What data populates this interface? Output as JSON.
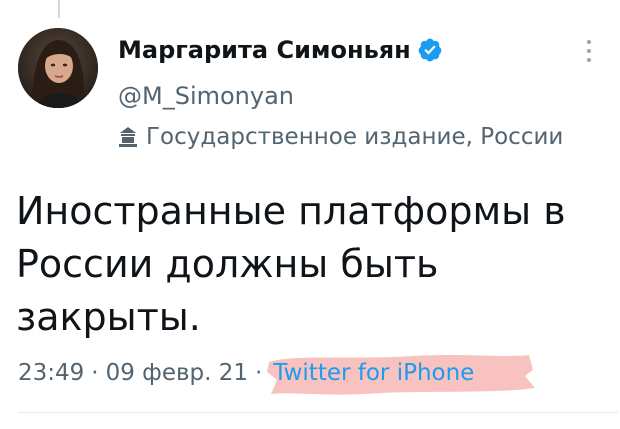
{
  "tweet": {
    "author": {
      "display_name": "Маргарита Симоньян",
      "handle": "@M_Simonyan",
      "verified": true,
      "avatar_icon": "profile-photo"
    },
    "affiliation": {
      "icon": "state-media-icon",
      "label": "Государственное издание, России"
    },
    "text": "Иностранные платформы в России должны быть закрыты.",
    "meta": {
      "time": "23:49",
      "separator": "·",
      "date": "09 февр. 21",
      "source": "Twitter for iPhone"
    },
    "more_icon": "more-vertical-icon"
  },
  "colors": {
    "primary_text": "#0f1419",
    "secondary_text": "#536471",
    "accent": "#1d9bf0",
    "verified_badge": "#1d9bf0",
    "source_highlight": "#f6b7b5"
  }
}
